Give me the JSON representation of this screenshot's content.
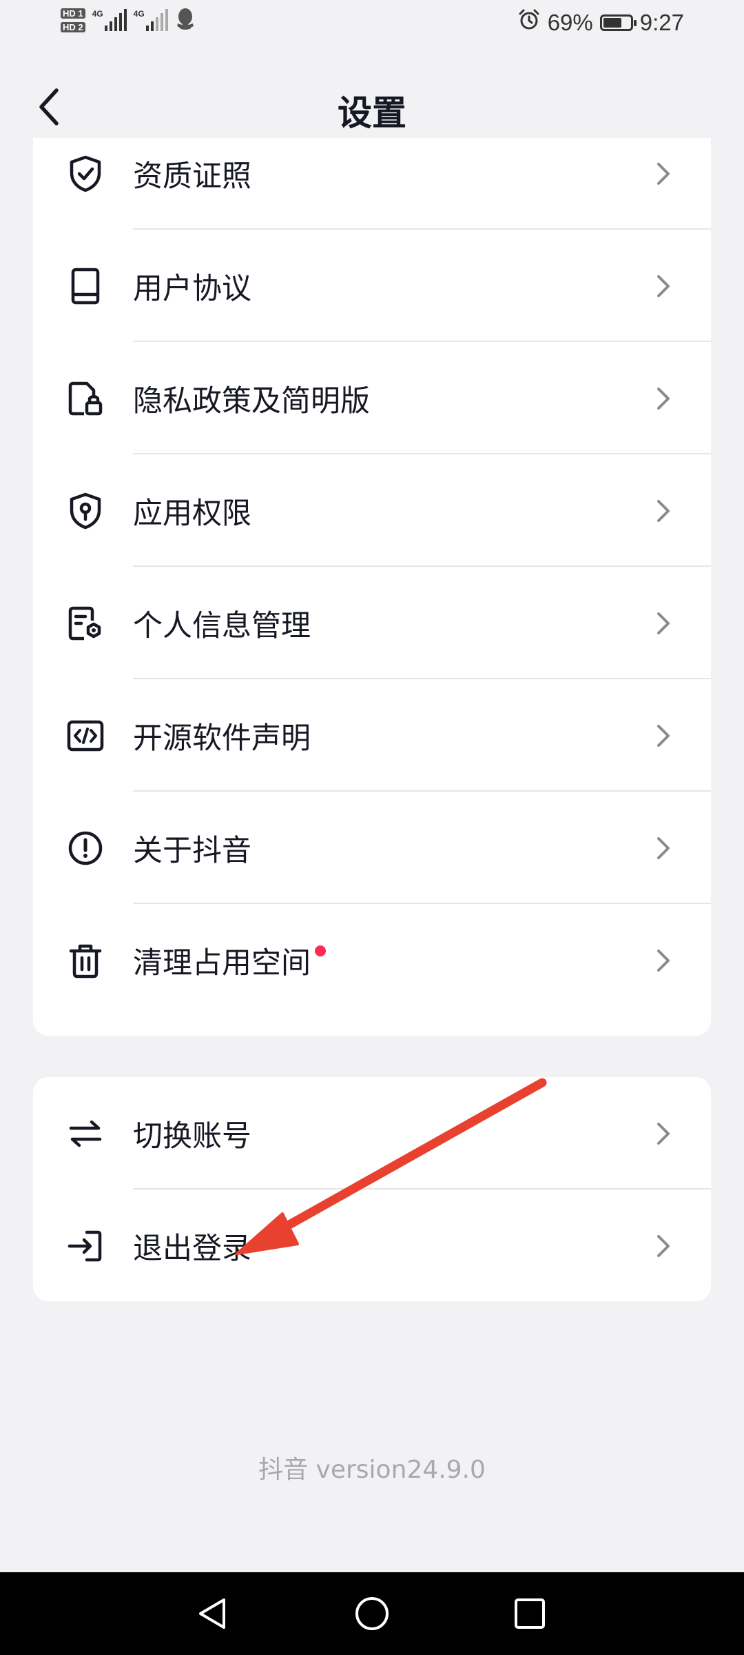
{
  "status_bar": {
    "sim1": "HD 1",
    "sim2": "HD 2",
    "network1": "4G",
    "network2": "4G",
    "battery_percent": "69%",
    "battery_level": 0.69,
    "time": "9:27",
    "icons": [
      "alarm-icon",
      "battery-icon",
      "qq-icon"
    ]
  },
  "header": {
    "title": "设置",
    "back_icon": "chevron-left-icon"
  },
  "settings_list": [
    {
      "label": "资质证照",
      "icon": "shield-check-icon"
    },
    {
      "label": "用户协议",
      "icon": "book-icon"
    },
    {
      "label": "隐私政策及简明版",
      "icon": "document-lock-icon"
    },
    {
      "label": "应用权限",
      "icon": "shield-person-icon"
    },
    {
      "label": "个人信息管理",
      "icon": "document-gear-icon"
    },
    {
      "label": "开源软件声明",
      "icon": "code-icon"
    },
    {
      "label": "关于抖音",
      "icon": "info-circle-icon"
    },
    {
      "label": "清理占用空间",
      "icon": "trash-icon",
      "badge": "red-dot"
    }
  ],
  "account_list": [
    {
      "label": "切换账号",
      "icon": "swap-icon"
    },
    {
      "label": "退出登录",
      "icon": "logout-icon"
    }
  ],
  "footer": {
    "version": "抖音 version24.9.0"
  },
  "annotation": {
    "arrow_color": "#e8412f"
  },
  "colors": {
    "background": "#f2f2f4",
    "card": "#ffffff",
    "text": "#161823",
    "badge": "#fe2c55",
    "muted": "#a9a9ad"
  }
}
